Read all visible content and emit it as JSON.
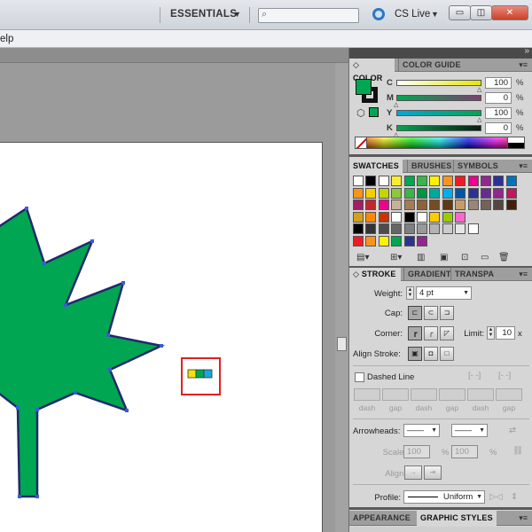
{
  "titlebar": {
    "workspace": "ESSENTIALS",
    "search_placeholder": "",
    "cs_live": "CS Live",
    "window_buttons": {
      "minimize": "▭",
      "maximize": "◫",
      "close": "✕"
    }
  },
  "menubar": {
    "help": "elp"
  },
  "colors": {
    "accent_green": "#00a651",
    "leaf_outline": "#1f2a6b",
    "highlight_box": "#e0201f"
  },
  "color_panel": {
    "tabs": [
      "◇ COLOR",
      "COLOR GUIDE"
    ],
    "sliders": [
      {
        "label": "C",
        "value": "100",
        "unit": "%",
        "fill": "#e3e800"
      },
      {
        "label": "M",
        "value": "0",
        "unit": "%",
        "fill": "#00a651"
      },
      {
        "label": "Y",
        "value": "100",
        "unit": "%",
        "fill": "#00a8d6"
      },
      {
        "label": "K",
        "value": "0",
        "unit": "%",
        "fill": "#00a651"
      }
    ]
  },
  "swatches_panel": {
    "tabs": [
      "SWATCHES",
      "BRUSHES",
      "SYMBOLS"
    ],
    "rows": [
      [
        "#ffffff",
        "#000000",
        "#ffffff",
        "#f9ed32",
        "#00a651",
        "#39b54a",
        "#fff200",
        "#f7941d",
        "#ed1c24",
        "#ec008c",
        "#92278f",
        "#2e3192",
        "#0072bc"
      ],
      [
        "#f7941d",
        "#f5d000",
        "#c4d600",
        "#8dc63f",
        "#39b54a",
        "#009444",
        "#00a99d",
        "#00aeef",
        "#0054a6",
        "#2e3192",
        "#662d91",
        "#92278f",
        "#c2185b"
      ],
      [
        "#9e1f63",
        "#c1272d",
        "#ec008c",
        "#c7b299",
        "#a67c52",
        "#8c6239",
        "#754c24",
        "#603813",
        "#c69c6d",
        "#998675",
        "#736357",
        "#534741",
        "#42210b"
      ],
      [
        "#d4a017",
        "#ff8800",
        "#cc3300",
        "#ffffff",
        "#000000",
        "#ffffff",
        "#ffcc00",
        "#99cc00",
        "#ff66cc"
      ],
      [
        "#000000",
        "#333333",
        "#4d4d4d",
        "#666666",
        "#808080",
        "#999999",
        "#b3b3b3",
        "#cccccc",
        "#e6e6e6",
        "#ffffff"
      ],
      [
        "#ed1c24",
        "#f7941d",
        "#fff200",
        "#00a651",
        "#2e3192",
        "#92278f"
      ]
    ]
  },
  "stroke_panel": {
    "tabs": [
      "◇ STROKE",
      "GRADIENT",
      "TRANSPA"
    ],
    "weight_label": "Weight:",
    "weight_value": "4 pt",
    "cap_label": "Cap:",
    "corner_label": "Corner:",
    "limit_label": "Limit:",
    "limit_value": "10",
    "limit_unit": "x",
    "align_label": "Align Stroke:",
    "dashed_label": "Dashed Line",
    "dash_gap_labels": [
      "dash",
      "gap",
      "dash",
      "gap",
      "dash",
      "gap"
    ],
    "arrowheads_label": "Arrowheads:",
    "scale_label": "Scale:",
    "scale_values": [
      "100",
      "100"
    ],
    "scale_unit": "%",
    "align_arrow_label": "Align:",
    "profile_label": "Profile:",
    "profile_value": "Uniform"
  },
  "appearance_panel": {
    "tabs": [
      "APPEARANCE",
      "GRAPHIC STYLES"
    ]
  }
}
